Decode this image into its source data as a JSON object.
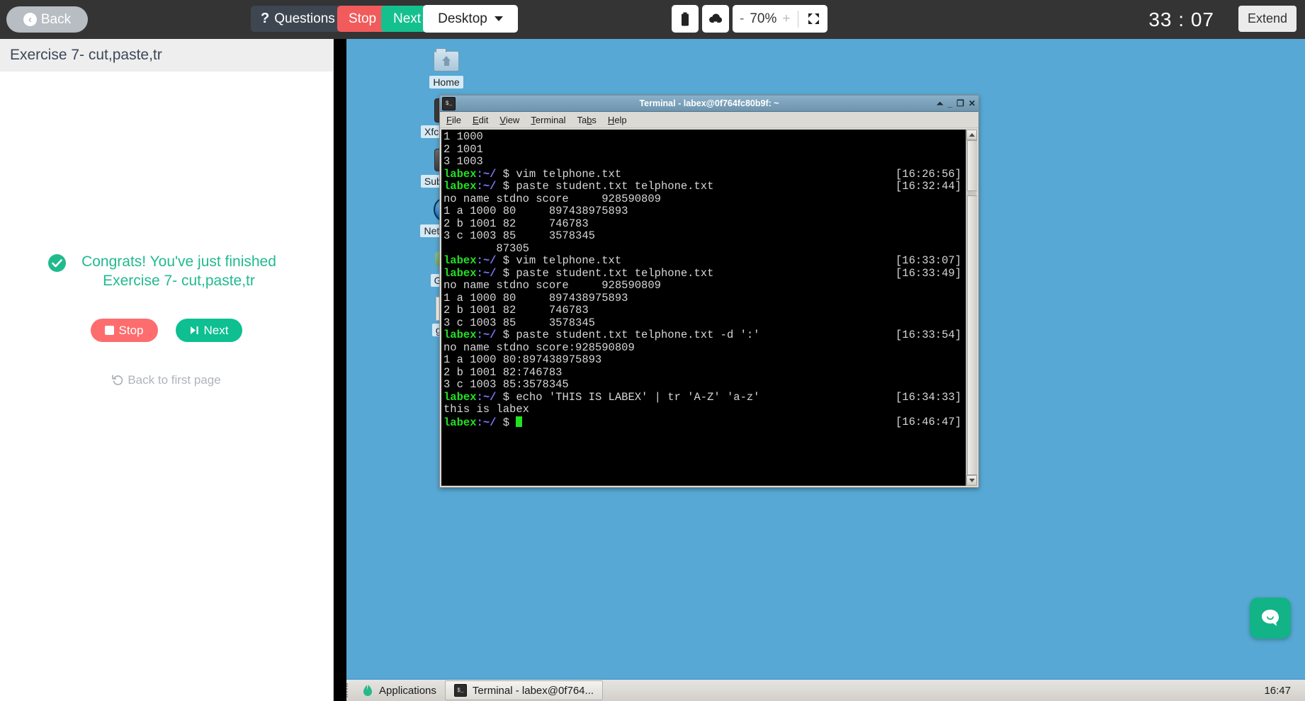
{
  "topbar": {
    "back_label": "Back",
    "back_icon": "circle-arrow-left-icon",
    "questions_label": "Questions",
    "questions_icon": "question-mark-icon",
    "stop_label": "Stop",
    "next_label": "Next",
    "desktop_label": "Desktop",
    "desktop_caret_icon": "chevron-down-icon",
    "clipboard_icon": "clipboard-icon",
    "upload_icon": "cloud-upload-icon",
    "zoom_minus": "-",
    "zoom_value": "70%",
    "zoom_plus": "+",
    "fullscreen_icon": "fullscreen-expand-icon",
    "timer": "33 : 07",
    "extend_label": "Extend"
  },
  "left_panel": {
    "header_title": "Exercise 7- cut,paste,tr",
    "check_icon": "check-circle-icon",
    "congrats_line1": "Congrats! You've just finished",
    "congrats_line2": "Exercise 7- cut,paste,tr",
    "stop_label": "Stop",
    "next_label": "Next",
    "back_first_label": "Back to first page",
    "back_first_icon": "undo-arrow-icon",
    "accent_green": "#21ba8f",
    "accent_red": "#fd6d6d"
  },
  "desktop": {
    "background": "#57a8d4",
    "icons": [
      {
        "label": "Home",
        "icon": "home-folder-icon"
      },
      {
        "label": "Xfce Ter...",
        "icon": "terminal-icon"
      },
      {
        "label": "Sublime...",
        "icon": "sublime-text-icon"
      },
      {
        "label": "NetSurf ...",
        "icon": "netsurf-browser-icon"
      },
      {
        "label": "GVim",
        "icon": "gvim-icon"
      },
      {
        "label": "gedit",
        "icon": "gedit-icon"
      }
    ]
  },
  "terminal": {
    "title": "Terminal - labex@0f764fc80b9f: ~",
    "window_icon": "terminal-icon",
    "titlebar_buttons": [
      "shade-icon",
      "minimize-icon",
      "maximize-icon",
      "close-icon"
    ],
    "menu": [
      "File",
      "Edit",
      "View",
      "Terminal",
      "Tabs",
      "Help"
    ],
    "prompt_host": "labex",
    "prompt_path": ":~/",
    "prompt_sign": "$",
    "lines": [
      {
        "type": "out",
        "text": "1 1000"
      },
      {
        "type": "out",
        "text": "2 1001"
      },
      {
        "type": "out",
        "text": "3 1003"
      },
      {
        "type": "cmd",
        "text": "vim telphone.txt",
        "time": "[16:26:56]"
      },
      {
        "type": "cmd",
        "text": "paste student.txt telphone.txt",
        "time": "[16:32:44]"
      },
      {
        "type": "out",
        "text": "no name stdno score     928590809"
      },
      {
        "type": "out",
        "text": "1 a 1000 80     897438975893"
      },
      {
        "type": "out",
        "text": "2 b 1001 82     746783"
      },
      {
        "type": "out",
        "text": "3 c 1003 85     3578345"
      },
      {
        "type": "out",
        "text": "        87305"
      },
      {
        "type": "cmd",
        "text": "vim telphone.txt",
        "time": "[16:33:07]"
      },
      {
        "type": "cmd",
        "text": "paste student.txt telphone.txt",
        "time": "[16:33:49]"
      },
      {
        "type": "out",
        "text": "no name stdno score     928590809"
      },
      {
        "type": "out",
        "text": "1 a 1000 80     897438975893"
      },
      {
        "type": "out",
        "text": "2 b 1001 82     746783"
      },
      {
        "type": "out",
        "text": "3 c 1003 85     3578345"
      },
      {
        "type": "cmd",
        "text": "paste student.txt telphone.txt -d ':'",
        "time": "[16:33:54]"
      },
      {
        "type": "out",
        "text": "no name stdno score:928590809"
      },
      {
        "type": "out",
        "text": "1 a 1000 80:897438975893"
      },
      {
        "type": "out",
        "text": "2 b 1001 82:746783"
      },
      {
        "type": "out",
        "text": "3 c 1003 85:3578345"
      },
      {
        "type": "cmd",
        "text": "echo 'THIS IS LABEX' | tr 'A-Z' 'a-z'",
        "time": "[16:34:33]"
      },
      {
        "type": "out",
        "text": "this is labex"
      },
      {
        "type": "cursor",
        "text": "",
        "time": "[16:46:47]"
      }
    ]
  },
  "taskbar": {
    "applications_label": "Applications",
    "applications_icon": "xfce-mouse-icon",
    "task_label": "Terminal - labex@0f764...",
    "task_icon": "terminal-icon",
    "clock": "16:47"
  },
  "chat": {
    "icon": "chat-bubble-icon",
    "color": "#12b386"
  }
}
